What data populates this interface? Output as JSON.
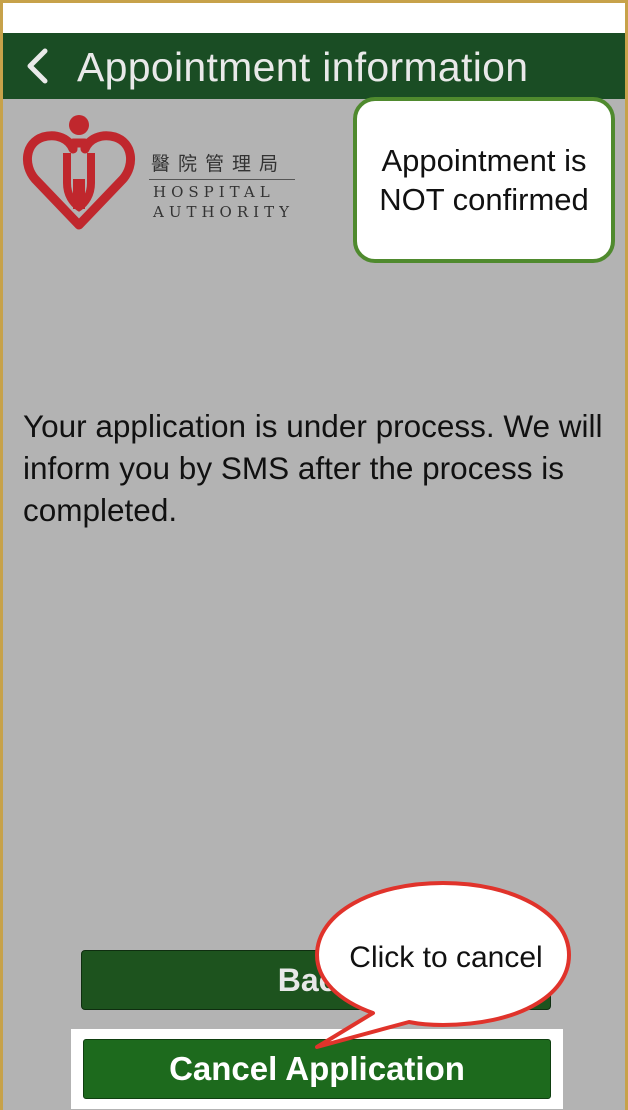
{
  "nav": {
    "back_icon": "chevron-left-icon",
    "title": "Appointment information"
  },
  "logo": {
    "chinese_name": "醫院管理局",
    "english_line1": "HOSPITAL",
    "english_line2": "AUTHORITY",
    "brand_red": "#c0272d"
  },
  "annotations": {
    "status_callout": "Appointment is NOT confirmed",
    "click_callout": "Click to cancel"
  },
  "main": {
    "message": "Your application is under process. We will inform you by SMS after the process is completed."
  },
  "buttons": {
    "back_label": "Back",
    "cancel_label": "Cancel Application"
  },
  "colors": {
    "nav_bg": "#1a4d24",
    "page_bg": "#b3b3b3",
    "button_green": "#1d6a1d",
    "callout_border": "#4f8a2e",
    "bubble_border": "#e0332b"
  }
}
